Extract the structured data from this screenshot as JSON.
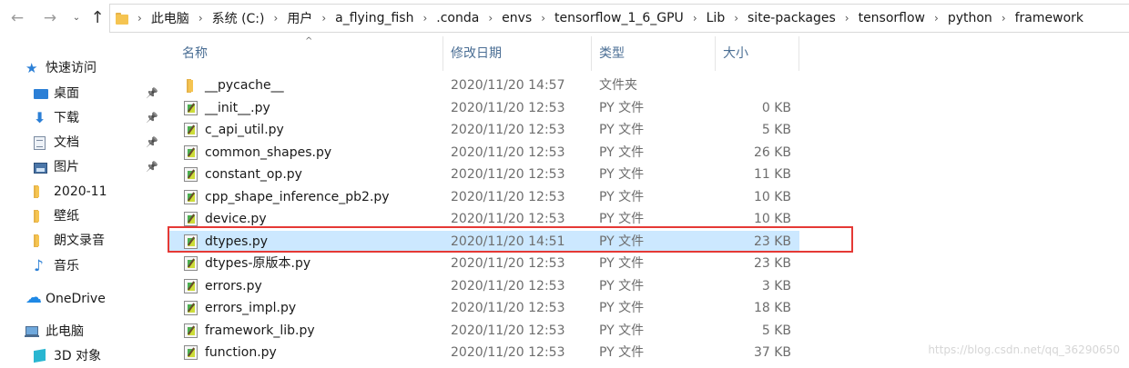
{
  "toolbar": {
    "back_icon": "←",
    "forward_icon": "→",
    "recent_icon": "⌄",
    "up_icon": "↑"
  },
  "breadcrumbs": [
    "此电脑",
    "系统 (C:)",
    "用户",
    "a_flying_fish",
    ".conda",
    "envs",
    "tensorflow_1_6_GPU",
    "Lib",
    "site-packages",
    "tensorflow",
    "python",
    "framework"
  ],
  "nav": {
    "items": [
      {
        "label": "快速访问",
        "icon": "star-icon",
        "pinned": false
      },
      {
        "label": "桌面",
        "icon": "desktop-icon",
        "pinned": true
      },
      {
        "label": "下载",
        "icon": "download-icon",
        "pinned": true
      },
      {
        "label": "文档",
        "icon": "document-icon",
        "pinned": true
      },
      {
        "label": "图片",
        "icon": "pictures-icon",
        "pinned": true
      },
      {
        "label": "2020-11",
        "icon": "folder-icon",
        "pinned": false
      },
      {
        "label": "壁纸",
        "icon": "folder-icon",
        "pinned": false
      },
      {
        "label": "朗文录音",
        "icon": "folder-icon",
        "pinned": false
      },
      {
        "label": "音乐",
        "icon": "music-icon",
        "pinned": false
      },
      {
        "label": "OneDrive",
        "icon": "cloud-icon",
        "pinned": false
      },
      {
        "label": "此电脑",
        "icon": "computer-icon",
        "pinned": false
      },
      {
        "label": "3D 对象",
        "icon": "3d-objects-icon",
        "pinned": false
      }
    ]
  },
  "list": {
    "columns": {
      "name": "名称",
      "date": "修改日期",
      "type": "类型",
      "size": "大小"
    },
    "sort_indicator": "^",
    "files": [
      {
        "name": "__pycache__",
        "date": "2020/11/20 14:57",
        "type": "文件夹",
        "size": "",
        "kind": "folder"
      },
      {
        "name": "__init__.py",
        "date": "2020/11/20 12:53",
        "type": "PY 文件",
        "size": "0 KB",
        "kind": "py"
      },
      {
        "name": "c_api_util.py",
        "date": "2020/11/20 12:53",
        "type": "PY 文件",
        "size": "5 KB",
        "kind": "py"
      },
      {
        "name": "common_shapes.py",
        "date": "2020/11/20 12:53",
        "type": "PY 文件",
        "size": "26 KB",
        "kind": "py"
      },
      {
        "name": "constant_op.py",
        "date": "2020/11/20 12:53",
        "type": "PY 文件",
        "size": "11 KB",
        "kind": "py"
      },
      {
        "name": "cpp_shape_inference_pb2.py",
        "date": "2020/11/20 12:53",
        "type": "PY 文件",
        "size": "10 KB",
        "kind": "py"
      },
      {
        "name": "device.py",
        "date": "2020/11/20 12:53",
        "type": "PY 文件",
        "size": "10 KB",
        "kind": "py"
      },
      {
        "name": "dtypes.py",
        "date": "2020/11/20 14:51",
        "type": "PY 文件",
        "size": "23 KB",
        "kind": "py",
        "selected": true
      },
      {
        "name": "dtypes-原版本.py",
        "date": "2020/11/20 12:53",
        "type": "PY 文件",
        "size": "23 KB",
        "kind": "py"
      },
      {
        "name": "errors.py",
        "date": "2020/11/20 12:53",
        "type": "PY 文件",
        "size": "3 KB",
        "kind": "py"
      },
      {
        "name": "errors_impl.py",
        "date": "2020/11/20 12:53",
        "type": "PY 文件",
        "size": "18 KB",
        "kind": "py"
      },
      {
        "name": "framework_lib.py",
        "date": "2020/11/20 12:53",
        "type": "PY 文件",
        "size": "5 KB",
        "kind": "py"
      },
      {
        "name": "function.py",
        "date": "2020/11/20 12:53",
        "type": "PY 文件",
        "size": "37 KB",
        "kind": "py"
      }
    ]
  },
  "watermark": "https://blog.csdn.net/qq_36290650",
  "colors": {
    "selection": "#cce8ff",
    "highlight_border": "#e53935",
    "accent": "#2b7fd6"
  }
}
